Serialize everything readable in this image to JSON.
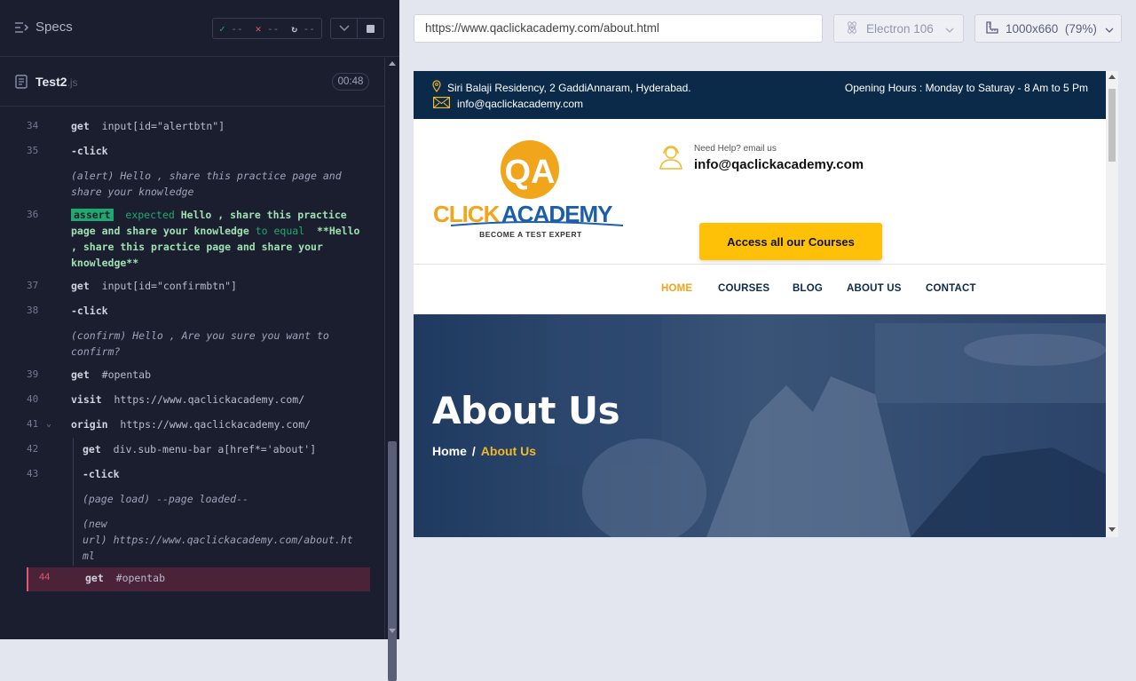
{
  "runner": {
    "specs_label": "Specs",
    "stats": {
      "passed": "--",
      "failed": "--",
      "pending": "--"
    },
    "spec_name": "Test2",
    "spec_ext": ".js",
    "duration": "00:48"
  },
  "commands": [
    {
      "num": "34",
      "name": "get",
      "arg": "input[id=\"alertbtn\"]"
    },
    {
      "num": "35",
      "name": "-click",
      "arg": ""
    },
    {
      "num": "",
      "line1": "(alert)  Hello , share this practice page and",
      "line2": "share your knowledge"
    },
    {
      "num": "36",
      "badge": "assert",
      "text": "expected",
      "bold1": "Hello , share this practice",
      "bold2": "page and share your knowledge",
      "mid": "to equal",
      "bold3": "**Hello",
      "bold4": ", share this practice page and share your",
      "bold5": "knowledge**"
    },
    {
      "num": "37",
      "name": "get",
      "arg": "input[id=\"confirmbtn\"]"
    },
    {
      "num": "38",
      "name": "-click",
      "arg": ""
    },
    {
      "num": "",
      "line1": "(confirm)  Hello , Are you sure you want to",
      "line2": "confirm?"
    },
    {
      "num": "39",
      "name": "get",
      "arg": "#opentab"
    },
    {
      "num": "40",
      "name": "visit",
      "arg": "https://www.qaclickacademy.com/"
    },
    {
      "num": "41",
      "name": "origin",
      "arg": "https://www.qaclickacademy.com/"
    },
    {
      "num": "42",
      "name": "get",
      "arg": "div.sub-menu-bar a[href*='about']"
    },
    {
      "num": "43",
      "name": "-click",
      "arg": ""
    },
    {
      "num": "",
      "line1": "(page load)  --page loaded--"
    },
    {
      "num": "",
      "line1": "(new",
      "line2": "url)  https://www.qaclickacademy.com/about.ht",
      "line3": "ml"
    },
    {
      "num": "44",
      "name": "get",
      "arg": "#opentab"
    }
  ],
  "aut": {
    "url": "https://www.qaclickacademy.com/about.html",
    "browser": "Electron 106",
    "viewport": "1000x660",
    "zoom": "(79%)"
  },
  "site": {
    "address": "Siri Balaji Residency, 2 GaddiAnnaram, Hyderabad.",
    "email_top": "info@qaclickacademy.com",
    "hours": "Opening Hours : Monday to Saturay - 8 Am to 5 Pm",
    "help_small": "Need Help? email us",
    "help_email": "info@qaclickacademy.com",
    "courses_button": "Access all our Courses",
    "logo_qa": "QA",
    "logo_click": "CLICK",
    "logo_academy": "ACADEMY",
    "logo_tagline": "BECOME A TEST EXPERT",
    "nav": [
      "HOME",
      "COURSES",
      "BLOG",
      "ABOUT US",
      "CONTACT"
    ],
    "hero_title": "About Us",
    "crumb_home": "Home",
    "crumb_sep": "/",
    "crumb_current": "About Us"
  },
  "colors": {
    "runner_bg": "#1b1e2e",
    "site_navy": "#0b2a4a",
    "accent_yellow": "#ffc107",
    "nav_active": "#f0a51a",
    "pass_green": "#1fa971",
    "fail_red": "#e45770"
  }
}
